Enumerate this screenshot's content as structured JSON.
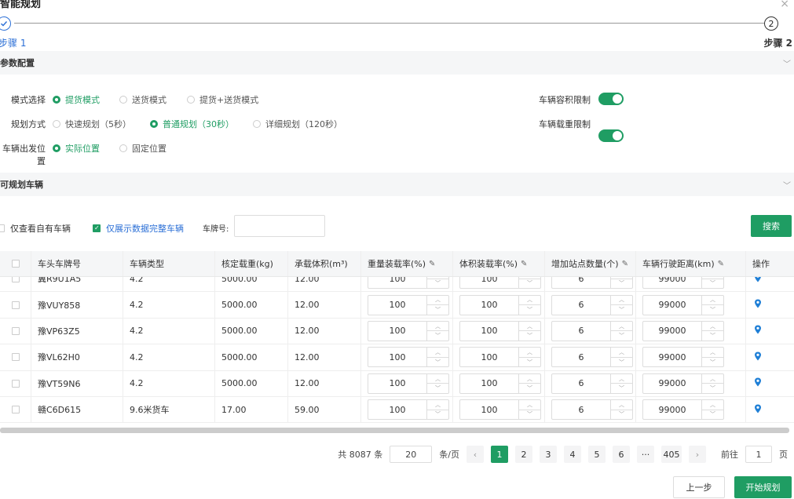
{
  "title": "智能规划",
  "steps": {
    "step1_label": "步骤 1",
    "step2_label": "步骤 2",
    "step2_num": "2"
  },
  "sections": {
    "config": "参数配置",
    "vehicles": "可规划车辆"
  },
  "config": {
    "mode_label": "模式选择",
    "mode_options": [
      "提货模式",
      "送货模式",
      "提货+送货模式"
    ],
    "mode_selected": "提货模式",
    "plan_label": "规划方式",
    "plan_options": [
      "快速规划（5秒）",
      "普通规划（30秒）",
      "详细规划（120秒）"
    ],
    "plan_selected": "普通规划（30秒）",
    "start_label": "车辆出发位置",
    "start_options": [
      "实际位置",
      "固定位置"
    ],
    "start_selected": "实际位置",
    "volume_limit_label": "车辆容积限制",
    "volume_limit_on": true,
    "weight_limit_label": "车辆载重限制",
    "weight_limit_on": true
  },
  "filters": {
    "own_only_label": "仅查看自有车辆",
    "own_only_checked": false,
    "complete_only_label": "仅展示数据完整车辆",
    "complete_only_checked": true,
    "plate_label": "车牌号:",
    "plate_value": "",
    "search_button": "搜索"
  },
  "table": {
    "headers": [
      "车头车牌号",
      "车辆类型",
      "核定载重(kg)",
      "承载体积(m³)",
      "重量装载率(%)",
      "体积装载率(%)",
      "增加站点数量(个)",
      "车辆行驶距离(km)",
      "操作"
    ],
    "rows": [
      {
        "plate": "冀R9U1A5",
        "type": "4.2",
        "load": "5000.00",
        "volume": "12.00",
        "weight_rate": "100",
        "volume_rate": "100",
        "stops": "6",
        "distance": "99000"
      },
      {
        "plate": "豫VUY858",
        "type": "4.2",
        "load": "5000.00",
        "volume": "12.00",
        "weight_rate": "100",
        "volume_rate": "100",
        "stops": "6",
        "distance": "99000"
      },
      {
        "plate": "豫VP63Z5",
        "type": "4.2",
        "load": "5000.00",
        "volume": "12.00",
        "weight_rate": "100",
        "volume_rate": "100",
        "stops": "6",
        "distance": "99000"
      },
      {
        "plate": "豫VL62H0",
        "type": "4.2",
        "load": "5000.00",
        "volume": "12.00",
        "weight_rate": "100",
        "volume_rate": "100",
        "stops": "6",
        "distance": "99000"
      },
      {
        "plate": "豫VT59N6",
        "type": "4.2",
        "load": "5000.00",
        "volume": "12.00",
        "weight_rate": "100",
        "volume_rate": "100",
        "stops": "6",
        "distance": "99000"
      },
      {
        "plate": "赣C6D615",
        "type": "9.6米货车",
        "load": "17.00",
        "volume": "59.00",
        "weight_rate": "100",
        "volume_rate": "100",
        "stops": "6",
        "distance": "99000"
      }
    ]
  },
  "pagination": {
    "total": "共 8087 条",
    "page_size": "20",
    "page_size_unit": "条/页",
    "pages": [
      "1",
      "2",
      "3",
      "4",
      "5",
      "6",
      "···",
      "405"
    ],
    "current": "1",
    "goto_label": "前往",
    "goto_value": "1",
    "goto_unit": "页"
  },
  "footer": {
    "prev_button": "上一步",
    "start_button": "开始规划"
  },
  "colors": {
    "accent": "#1f9d63",
    "step_active": "#2b6fd6",
    "pin": "#1f7fd6"
  }
}
